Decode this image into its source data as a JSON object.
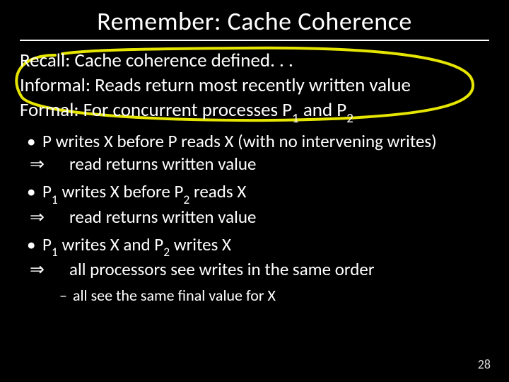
{
  "title": "Remember: Cache Coherence",
  "intro": {
    "line1": "Recall: Cache coherence defined. . .",
    "line2": "Informal: Reads return most recently written value",
    "line3_pre": "Formal: For concurrent processes P",
    "line3_sub1": "1",
    "line3_mid": " and P",
    "line3_sub2": "2"
  },
  "bullets": [
    {
      "main": "P writes X before P reads X (with no intervening writes)",
      "impl": "read returns written value"
    },
    {
      "p1": "P",
      "s1": "1",
      "mid1": " writes X before P",
      "s2": "2",
      "mid2": " reads X",
      "impl": "read returns written value"
    },
    {
      "p1": "P",
      "s1": "1",
      "mid1": " writes X and P",
      "s2": "2",
      "mid2": " writes X",
      "impl": "all processors see writes in the same order"
    }
  ],
  "subdash": "all see the same final value for X",
  "implies_glyph": "⇒",
  "page_number": "28"
}
